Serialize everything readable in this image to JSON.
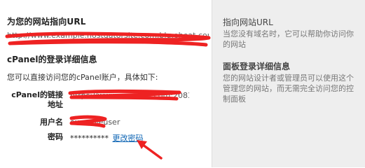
{
  "main": {
    "site_url_heading": "为您的网站指向URL",
    "site_url_value": "http://www.example.hostgatorsite.com.blu.eheat.com",
    "cpanel_heading": "cPanel的登录详细信息",
    "cpanel_description": "您可以直接访问您的cPanel账户，具体如下:",
    "credentials": {
      "link_label_line1": "cPanel的链接",
      "link_label_line2": "地址",
      "link_value": "https://www.example.com:2083/",
      "username_label": "用户名",
      "username_value": "exampleuser",
      "password_label": "密码",
      "password_value": "**********",
      "change_password_label": "更改密码"
    }
  },
  "sidebar": {
    "url_help": {
      "title": "指向网站URL",
      "body": "当您没有域名时，它可以帮助你访问你的网站"
    },
    "cpanel_help": {
      "title": "面板登录详细信息",
      "body": "您的网站设计者或管理员可以使用这个管理您的网站，而无需完全访问您的控制面板"
    }
  },
  "colors": {
    "redaction": "#ee2222",
    "link": "#0b63b3",
    "sidebar_bg": "#eeeeee"
  }
}
